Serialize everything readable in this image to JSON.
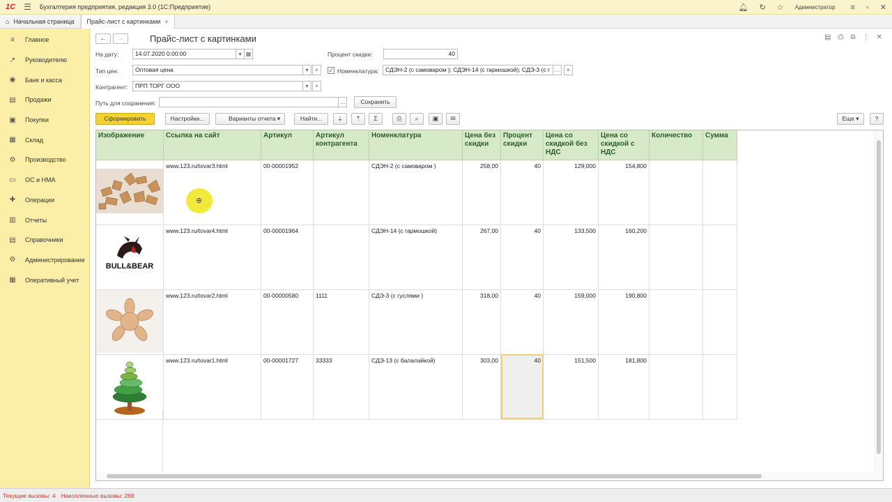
{
  "app": {
    "logo": "1С",
    "title": "Бухгалтерия предприятия, редакция 3.0  (1С:Предприятие)",
    "user": "Администратор"
  },
  "tabs": [
    {
      "label": "Начальная страница"
    },
    {
      "label": "Прайс-лист с картинками",
      "close": "×"
    }
  ],
  "sidebar": {
    "items": [
      {
        "label": "Главное",
        "icon": "≡"
      },
      {
        "label": "Руководителю",
        "icon": "↗"
      },
      {
        "label": "Банк и касса",
        "icon": "◉"
      },
      {
        "label": "Продажи",
        "icon": "▤"
      },
      {
        "label": "Покупки",
        "icon": "▣"
      },
      {
        "label": "Склад",
        "icon": "▦"
      },
      {
        "label": "Производство",
        "icon": "⚙"
      },
      {
        "label": "ОС и НМА",
        "icon": "▭"
      },
      {
        "label": "Операции",
        "icon": "✚"
      },
      {
        "label": "Отчеты",
        "icon": "▥"
      },
      {
        "label": "Справочники",
        "icon": "▤"
      },
      {
        "label": "Администрирование",
        "icon": "⚙"
      },
      {
        "label": "Оперативный учет",
        "icon": "▦"
      }
    ]
  },
  "form": {
    "title": "Прайс-лист с картинками",
    "date_label": "На дату:",
    "date_value": "14.07.2020  0:00:00",
    "discount_label": "Процент скидки:",
    "discount_value": "40",
    "price_type_label": "Тип цен:",
    "price_type_value": "Оптовая цена",
    "nomenclature_label": "Номенклатура:",
    "nomenclature_value": "СДЭН-2 (с самоваром ); СДЭН-14 (с гармошкой); СДЭ-3 (с г",
    "counterparty_label": "Контрагент:",
    "counterparty_value": "ПРП ТОРГ ООО",
    "save_path_label": "Путь для сохранения:",
    "save_path_value": "",
    "save_button": "Сохранить"
  },
  "toolbar": {
    "generate": "Сформировать",
    "settings": "Настройки...",
    "variants": "Варианты отчета",
    "find": "Найти...",
    "more": "Еще",
    "help": "?"
  },
  "table": {
    "headers": [
      "Изображение",
      "Ссылка на сайт",
      "Артикул",
      "Артикул контрагента",
      "Номенклатура",
      "Цена без скидки",
      "Процент скидки",
      "Цена со скидкой без НДС",
      "Цена со скидкой с НДС",
      "Количество",
      "Сумма"
    ],
    "rows": [
      {
        "image": "wooden-blocks",
        "url": "www.123.ru/tovar3.html",
        "article": "00-00001952",
        "supplier_article": "",
        "name": "СДЭН-2 (с самоваром )",
        "price": "258,00",
        "discount": "40",
        "price_no_vat": "129,000",
        "price_vat": "154,800",
        "qty": "",
        "sum": ""
      },
      {
        "image": "bull-bear-logo",
        "url": "www.123.ru/tovar4.html",
        "article": "00-00001964",
        "supplier_article": "",
        "name": "СДЭН-14 (с гармошкой)",
        "price": "267,00",
        "discount": "40",
        "price_no_vat": "133,500",
        "price_vat": "160,200",
        "qty": "",
        "sum": ""
      },
      {
        "image": "wooden-star-toy",
        "url": "www.123.ru/tovar2.html",
        "article": "00-00000580",
        "supplier_article": "1111",
        "name": "СДЭ-3 (с гуслями )",
        "price": "318,00",
        "discount": "40",
        "price_no_vat": "159,000",
        "price_vat": "190,800",
        "qty": "",
        "sum": ""
      },
      {
        "image": "wooden-tree-toy",
        "url": "www.123.ru/tovar1.html",
        "article": "00-00001727",
        "supplier_article": "33333",
        "name": "СДЭ-13 (с балалайкой)",
        "price": "303,00",
        "discount": "40",
        "price_no_vat": "151,500",
        "price_vat": "181,800",
        "qty": "",
        "sum": ""
      }
    ],
    "bull_bear_text": "BULL&BEAR"
  },
  "status": {
    "current_calls": "Текущие вызовы: 4",
    "accumulated_calls": "Накопленные вызовы: 268"
  }
}
